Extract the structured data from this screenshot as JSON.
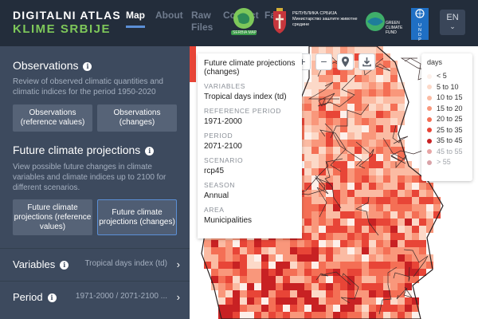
{
  "header": {
    "brand_line1": "DIGITALNI ATLAS",
    "brand_line2": "KLIME SRBIJE",
    "nav": [
      {
        "label": "Map",
        "active": true
      },
      {
        "label": "About",
        "active": false
      },
      {
        "label": "Raw Files",
        "active": false
      },
      {
        "label": "Contact",
        "active": false
      },
      {
        "label": "Faq",
        "active": false
      }
    ],
    "logos": {
      "serbia_map": "SERBIA MAP",
      "ministry": "РЕПУБЛИКА СРБИЈА Министарство заштите животне средине",
      "green_climate_fund": "GREEN CLIMATE FUND",
      "undp": "U N D P"
    },
    "language": "EN"
  },
  "sidebar": {
    "observations": {
      "title": "Observations",
      "description": "Review of observed climatic quantities and climatic indices for the period 1950-2020",
      "buttons": [
        "Observations (reference values)",
        "Observations (changes)"
      ]
    },
    "projections": {
      "title": "Future climate projections",
      "description": "View possible future changes in climate variables and climate indices up to 2100 for different scenarios.",
      "buttons": [
        "Future climate projections (reference values)",
        "Future climate projections (changes)"
      ],
      "selected_index": 1
    },
    "rows": [
      {
        "label": "Variables",
        "value": "Tropical days index (td)"
      },
      {
        "label": "Period",
        "value": "1971-2000 / 2071-2100 ..."
      }
    ]
  },
  "map_tools": [
    "zoom-in",
    "zoom-out",
    "location",
    "download"
  ],
  "info_panel": {
    "title": "Future climate projections (changes)",
    "fields": [
      {
        "label": "VARIABLES",
        "value": "Tropical days index (td)"
      },
      {
        "label": "REFERENCE PERIOD",
        "value": "1971-2000"
      },
      {
        "label": "PERIOD",
        "value": "2071-2100"
      },
      {
        "label": "SCENARIO",
        "value": "rcp45"
      },
      {
        "label": "SEASON",
        "value": "Annual"
      },
      {
        "label": "AREA",
        "value": "Municipalities"
      }
    ]
  },
  "legend": {
    "title": "days",
    "items": [
      {
        "label": "< 5",
        "color": "#fdf0ea",
        "muted": false
      },
      {
        "label": "5 to 10",
        "color": "#fcd9c8",
        "muted": false
      },
      {
        "label": "10 to 15",
        "color": "#fbbba3",
        "muted": false
      },
      {
        "label": "15 to 20",
        "color": "#f9977b",
        "muted": false
      },
      {
        "label": "20 to 25",
        "color": "#f46f55",
        "muted": false
      },
      {
        "label": "25 to 35",
        "color": "#e84537",
        "muted": false
      },
      {
        "label": "35 to 45",
        "color": "#c82123",
        "muted": false
      },
      {
        "label": "45 to 55",
        "color": "#e7a5a5",
        "muted": true
      },
      {
        "label": "> 55",
        "color": "#d9a3a8",
        "muted": true
      }
    ]
  }
}
